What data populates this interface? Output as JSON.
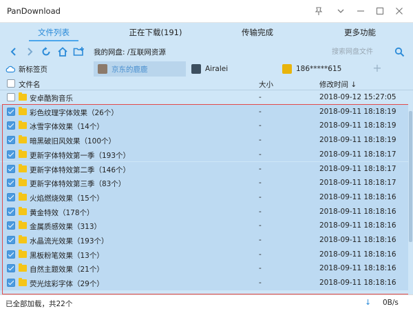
{
  "window": {
    "title": "PanDownload"
  },
  "tabs": [
    {
      "label": "文件列表",
      "active": true
    },
    {
      "label": "正在下载(191)",
      "active": false
    },
    {
      "label": "传输完成",
      "active": false
    },
    {
      "label": "更多功能",
      "active": false
    }
  ],
  "toolbar": {
    "path_label": "我的网盘: /互联网资源",
    "search_placeholder": "搜索网盘文件"
  },
  "sessions": [
    {
      "label": "新标签页",
      "icon": "cloud-icon",
      "active": false
    },
    {
      "label": "京东的鹿鹿",
      "icon": "avatar",
      "active": true
    },
    {
      "label": "Airalei",
      "icon": "avatar",
      "active": false
    },
    {
      "label": "186*****615",
      "icon": "avatar",
      "active": false
    }
  ],
  "table": {
    "headers": {
      "name": "文件名",
      "size": "大小",
      "time": "修改时间 ↓"
    },
    "rows": [
      {
        "name": "安卓酷狗音乐",
        "size": "-",
        "time": "2018-09-12 15:27:05",
        "checked": false
      },
      {
        "name": "彩色纹理字体效果（26个）",
        "size": "-",
        "time": "2018-09-11 18:18:19",
        "checked": true
      },
      {
        "name": "冰雪字体效果（14个）",
        "size": "-",
        "time": "2018-09-11 18:18:19",
        "checked": true
      },
      {
        "name": "暗黑破旧风效果（100个）",
        "size": "-",
        "time": "2018-09-11 18:18:19",
        "checked": true
      },
      {
        "name": "更新字体特效第一季（193个）",
        "size": "-",
        "time": "2018-09-11 18:18:17",
        "checked": true
      },
      {
        "name": "更新字体特效第二季（146个）",
        "size": "-",
        "time": "2018-09-11 18:18:17",
        "checked": true
      },
      {
        "name": "更新字体特效第三季（83个）",
        "size": "-",
        "time": "2018-09-11 18:18:17",
        "checked": true
      },
      {
        "name": "火焰燃烧效果（15个）",
        "size": "-",
        "time": "2018-09-11 18:18:16",
        "checked": true
      },
      {
        "name": "黄金特效（178个）",
        "size": "-",
        "time": "2018-09-11 18:18:16",
        "checked": true
      },
      {
        "name": "金属质感效果（313）",
        "size": "-",
        "time": "2018-09-11 18:18:16",
        "checked": true
      },
      {
        "name": "水晶流光效果（193个）",
        "size": "-",
        "time": "2018-09-11 18:18:16",
        "checked": true
      },
      {
        "name": "黑板粉笔效果（13个）",
        "size": "-",
        "time": "2018-09-11 18:18:16",
        "checked": true
      },
      {
        "name": "自然主题效果（21个）",
        "size": "-",
        "time": "2018-09-11 18:18:16",
        "checked": true
      },
      {
        "name": "荧光炫彩字体（29个）",
        "size": "-",
        "time": "2018-09-11 18:18:16",
        "checked": true
      }
    ]
  },
  "status": {
    "text": "已全部加载，共22个",
    "speed": "0B/s"
  },
  "colors": {
    "accent": "#2a8ad8",
    "panel": "#cfe6f7",
    "selection": "#e24a4a",
    "folder": "#f5c518"
  }
}
